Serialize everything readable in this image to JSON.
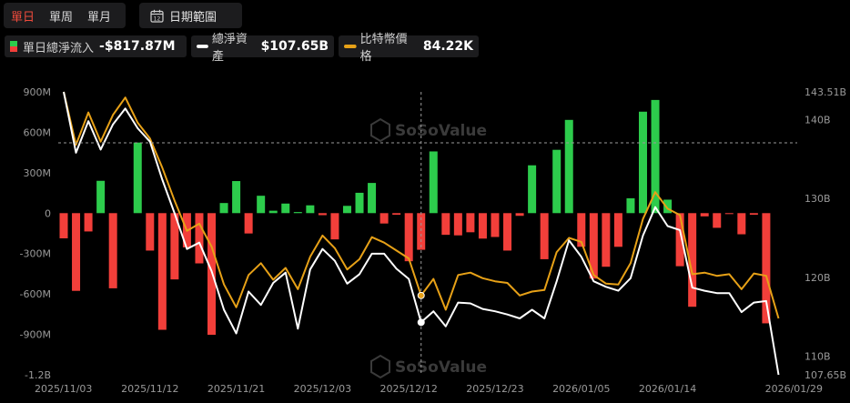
{
  "toolbar": {
    "tabs": [
      {
        "label": "單日",
        "active": true
      },
      {
        "label": "單周",
        "active": false
      },
      {
        "label": "單月",
        "active": false
      }
    ],
    "date_range_label": "日期範圍",
    "calendar_icon_number": "12"
  },
  "legend": [
    {
      "name": "單日總淨流入",
      "value": "-$817.87M",
      "icon": "bar-icon-green-red"
    },
    {
      "name": "總淨資產",
      "value": "$107.65B",
      "color": "#ffffff"
    },
    {
      "name": "比特幣價格",
      "value": "84.22K",
      "color": "#e7a117"
    }
  ],
  "watermark": "SoSoValue",
  "colors": {
    "positive": "#2dcc4c",
    "negative": "#f23f3a",
    "price": "#e7a117",
    "assets": "#ffffff"
  },
  "chart_data": {
    "type": "bar",
    "x_tick_labels": [
      "2025/11/03",
      "2025/11/12",
      "2025/11/21",
      "2025/12/03",
      "2025/12/12",
      "2025/12/23",
      "2026/01/05",
      "2026/01/14",
      "2026/01/29"
    ],
    "y_left_tick_labels": [
      "900M",
      "600M",
      "300M",
      "0",
      "-300M",
      "-600M",
      "-900M",
      "-1.2B"
    ],
    "y_left_range": [
      -1200,
      900
    ],
    "y_left_unit": "M USD",
    "y_right_tick_labels": [
      "143.51B",
      "140B",
      "130B",
      "120B",
      "110B",
      "107.65B"
    ],
    "y_right_range": [
      107.65,
      143.51
    ],
    "y_right_unit": "B USD",
    "dates": [
      "2025/11/03",
      "2025/11/04",
      "2025/11/05",
      "2025/11/06",
      "2025/11/07",
      "2025/11/10",
      "2025/11/11",
      "2025/11/12",
      "2025/11/13",
      "2025/11/14",
      "2025/11/17",
      "2025/11/18",
      "2025/11/19",
      "2025/11/20",
      "2025/11/21",
      "2025/11/24",
      "2025/11/25",
      "2025/11/26",
      "2025/11/28",
      "2025/12/01",
      "2025/12/02",
      "2025/12/03",
      "2025/12/04",
      "2025/12/05",
      "2025/12/08",
      "2025/12/09",
      "2025/12/10",
      "2025/12/11",
      "2025/12/12",
      "2025/12/15",
      "2025/12/16",
      "2025/12/17",
      "2025/12/18",
      "2025/12/19",
      "2025/12/22",
      "2025/12/23",
      "2025/12/24",
      "2025/12/26",
      "2025/12/29",
      "2025/12/30",
      "2025/12/31",
      "2026/01/02",
      "2026/01/05",
      "2026/01/06",
      "2026/01/07",
      "2026/01/08",
      "2026/01/09",
      "2026/01/12",
      "2026/01/13",
      "2026/01/14",
      "2026/01/15",
      "2026/01/16",
      "2026/01/20",
      "2026/01/21",
      "2026/01/22",
      "2026/01/23",
      "2026/01/26",
      "2026/01/27",
      "2026/01/28",
      "2026/01/29"
    ],
    "series": [
      {
        "name": "單日總淨流入",
        "kind": "bar",
        "axis": "left",
        "values": [
          -187,
          -577,
          -136,
          240,
          -558,
          0,
          524,
          -278,
          -866,
          -492,
          -254,
          -373,
          -903,
          75,
          238,
          -151,
          129,
          18,
          71,
          8,
          58,
          -15,
          -195,
          54,
          151,
          224,
          -77,
          -12,
          -357,
          -272,
          458,
          -161,
          -165,
          -142,
          -189,
          -177,
          -278,
          -20,
          355,
          -342,
          470,
          692,
          -250,
          -486,
          -398,
          -250,
          110,
          753,
          840,
          100,
          -394,
          -695,
          -24,
          -109,
          -7,
          -157,
          -12,
          -818
        ]
      },
      {
        "name": "比特幣價格",
        "kind": "line",
        "axis": "right",
        "values": [
          143.51,
          136.8,
          140.9,
          137.2,
          140.6,
          142.8,
          139.6,
          137.6,
          133.9,
          129.7,
          125.9,
          126.8,
          123.9,
          119.1,
          116.2,
          120.3,
          121.8,
          119.7,
          121.2,
          118.5,
          122.6,
          125.3,
          123.7,
          121.0,
          122.3,
          125.1,
          124.4,
          123.4,
          122.4,
          117.7,
          119.8,
          115.9,
          120.3,
          120.6,
          119.9,
          119.5,
          119.3,
          117.7,
          118.2,
          118.4,
          123.2,
          125.0,
          124.5,
          120.3,
          119.2,
          119.1,
          121.8,
          127.4,
          130.8,
          128.7,
          127.9,
          120.4,
          120.6,
          120.2,
          120.4,
          118.5,
          120.5,
          120.2,
          114.8
        ]
      },
      {
        "name": "總淨資產",
        "kind": "line",
        "axis": "right",
        "values": [
          143.51,
          135.8,
          139.8,
          136.2,
          139.4,
          141.4,
          138.9,
          137.2,
          132.4,
          128.1,
          123.6,
          124.4,
          120.8,
          115.9,
          112.9,
          118.2,
          116.5,
          119.3,
          120.6,
          113.5,
          121.0,
          123.6,
          122.1,
          119.2,
          120.4,
          123.0,
          123.0,
          121.1,
          119.8,
          114.3,
          115.7,
          113.8,
          116.8,
          116.7,
          116.0,
          115.7,
          115.3,
          114.8,
          115.9,
          114.8,
          119.5,
          124.7,
          122.6,
          119.5,
          118.8,
          118.3,
          119.9,
          125.3,
          128.9,
          126.5,
          126.0,
          118.7,
          118.3,
          118.0,
          118.0,
          115.6,
          116.8,
          117.0,
          107.65
        ]
      }
    ],
    "crosshair_date": "2025/12/15",
    "grid": false
  }
}
